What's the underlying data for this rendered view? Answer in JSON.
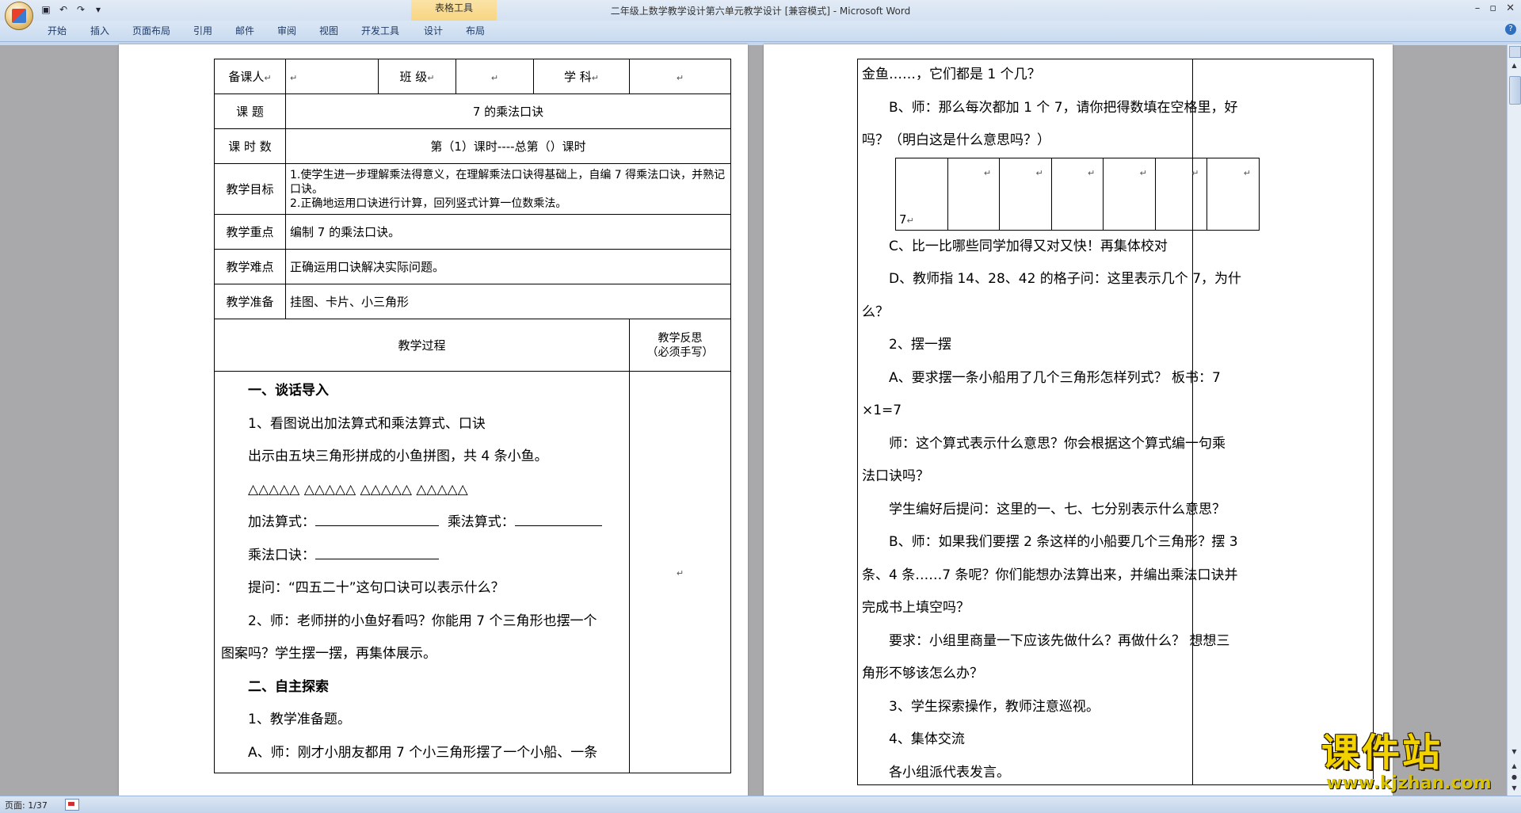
{
  "window": {
    "title": "二年级上数学教学设计第六单元教学设计 [兼容模式] - Microsoft Word",
    "contextual_tab_group": "表格工具"
  },
  "qat": {
    "save_icon": "save-icon",
    "undo_icon": "undo-icon",
    "redo_icon": "redo-icon",
    "customize_icon": "dropdown-icon"
  },
  "ribbon": {
    "tabs": [
      "开始",
      "插入",
      "页面布局",
      "引用",
      "邮件",
      "审阅",
      "视图",
      "开发工具",
      "设计",
      "布局"
    ]
  },
  "marks": {
    "cell": "↵"
  },
  "left_page": {
    "header": {
      "preparer_label": "备课人",
      "class_label": "班  级",
      "subject_label": "学  科"
    },
    "rows": {
      "topic_label": "课    题",
      "topic_value": "7 的乘法口诀",
      "period_label": "课 时 数",
      "period_value": "第（1）课时----总第（）课时",
      "goal_label": "教学目标",
      "goal_line1": "1.使学生进一步理解乘法得意义，在理解乘法口诀得基础上，自编 7 得乘法口诀，并熟记口诀。",
      "goal_line2": "2.正确地运用口诀进行计算，回列竖式计算一位数乘法。",
      "key_label": "教学重点",
      "key_value": "编制 7 的乘法口诀。",
      "difficulty_label": "教学难点",
      "difficulty_value": "正确运用口诀解决实际问题。",
      "prep_label": "教学准备",
      "prep_value": "挂图、卡片、小三角形"
    },
    "process_header": "教学过程",
    "reflection_header_1": "教学反思",
    "reflection_header_2": "（必须手写）",
    "process": {
      "p1": "一、谈话导入",
      "p2": "1、看图说出加法算式和乘法算式、口诀",
      "p3": "出示由五块三角形拼成的小鱼拼图，共 4 条小鱼。",
      "p4": "△△△△△  △△△△△  △△△△△  △△△△△",
      "p5_a": "加法算式：",
      "p5_b": "乘法算式：",
      "p6": "乘法口诀：",
      "p7": "提问：“四五二十”这句口诀可以表示什么？",
      "p8": "2、师：老师拼的小鱼好看吗？你能用 7 个三角形也摆一个",
      "p9": "图案吗？学生摆一摆，再集体展示。",
      "p10": "二、自主探索",
      "p11": "1、教学准备题。",
      "p12": "A、师：刚才小朋友都用 7 个小三角形摆了一个小船、一条"
    }
  },
  "right_page": {
    "r1": "金鱼……，它们都是 1 个几？",
    "r2": "B、师：那么每次都加 1 个 7，请你把得数填在空格里，好",
    "r3": "吗？（明白这是什么意思吗？）",
    "grid_first": "7",
    "r4": "C、比一比哪些同学加得又对又快！再集体校对",
    "r5": "D、教师指 14、28、42 的格子问：这里表示几个 7，为什",
    "r6": "么？",
    "r7": "2、摆一摆",
    "r8": "A、要求摆一条小船用了几个三角形怎样列式？   板书：7",
    "r9": "×1=7",
    "r10": "师：这个算式表示什么意思？你会根据这个算式编一句乘",
    "r11": "法口诀吗？",
    "r12": "学生编好后提问：这里的一、七、七分别表示什么意思？",
    "r13": "B、师：如果我们要摆 2 条这样的小船要几个三角形？摆 3",
    "r14": "条、4 条……7 条呢？你们能想办法算出来，并编出乘法口诀并",
    "r15": "完成书上填空吗？",
    "r16": "要求：小组里商量一下应该先做什么？再做什么？   想想三",
    "r17": "角形不够该怎么办？",
    "r18": "3、学生探索操作，教师注意巡视。",
    "r19": "4、集体交流",
    "r20": "各小组派代表发言。"
  },
  "status": {
    "page": "页面: 1/37"
  },
  "watermark": {
    "title": "课件站",
    "url": "www.kjzhan.com"
  }
}
